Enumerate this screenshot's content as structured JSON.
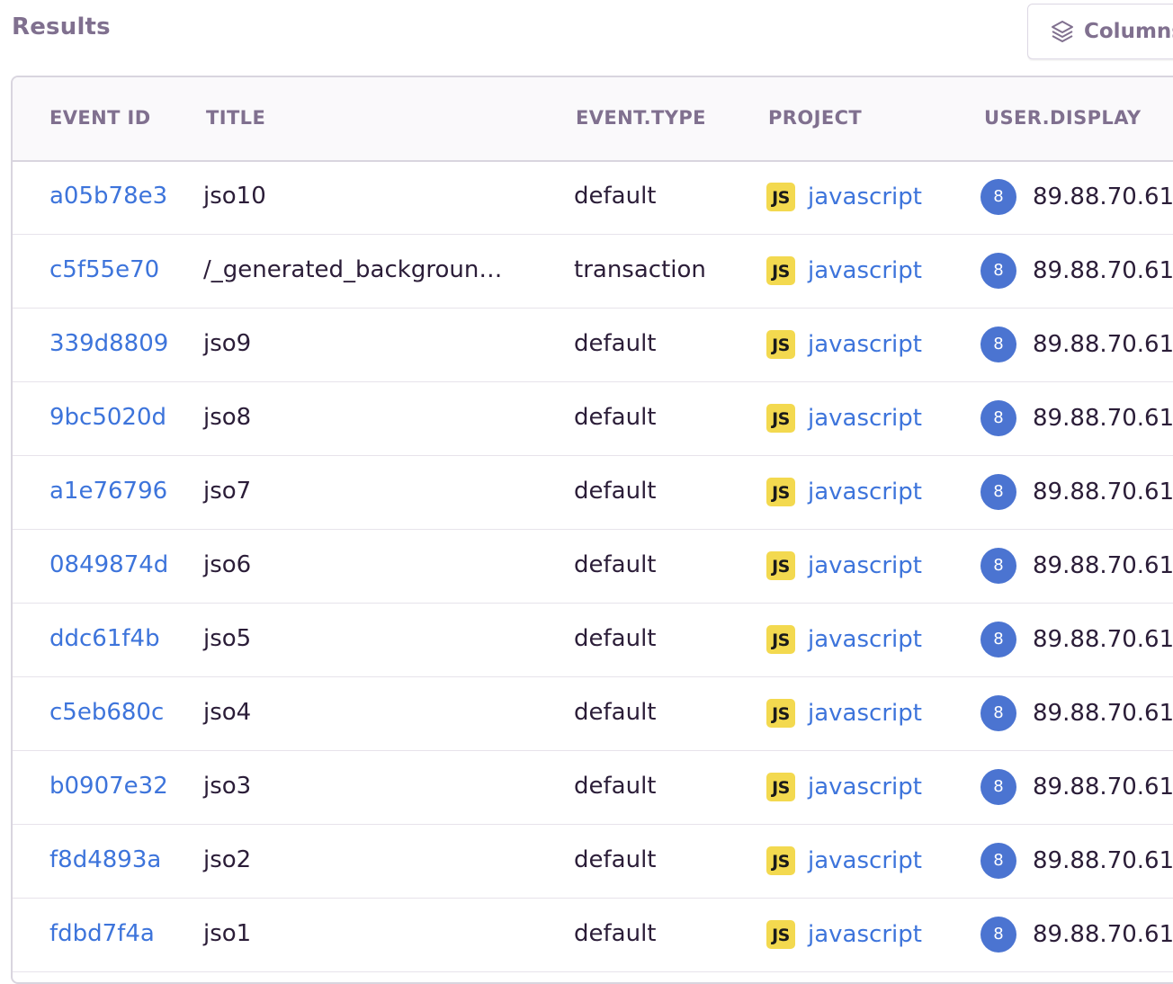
{
  "header": {
    "title": "Results",
    "columns_button_label": "Columns"
  },
  "table": {
    "columns": [
      "EVENT ID",
      "TITLE",
      "EVENT.TYPE",
      "PROJECT",
      "USER.DISPLAY"
    ],
    "rows": [
      {
        "event_id": "a05b78e3",
        "title": "jso10",
        "event_type": "default",
        "project": "javascript",
        "project_badge": "JS",
        "avatar": "8",
        "user_display": "89.88.70.61"
      },
      {
        "event_id": "c5f55e70",
        "title": "/_generated_backgroun…",
        "event_type": "transaction",
        "project": "javascript",
        "project_badge": "JS",
        "avatar": "8",
        "user_display": "89.88.70.61"
      },
      {
        "event_id": "339d8809",
        "title": "jso9",
        "event_type": "default",
        "project": "javascript",
        "project_badge": "JS",
        "avatar": "8",
        "user_display": "89.88.70.61"
      },
      {
        "event_id": "9bc5020d",
        "title": "jso8",
        "event_type": "default",
        "project": "javascript",
        "project_badge": "JS",
        "avatar": "8",
        "user_display": "89.88.70.61"
      },
      {
        "event_id": "a1e76796",
        "title": "jso7",
        "event_type": "default",
        "project": "javascript",
        "project_badge": "JS",
        "avatar": "8",
        "user_display": "89.88.70.61"
      },
      {
        "event_id": "0849874d",
        "title": "jso6",
        "event_type": "default",
        "project": "javascript",
        "project_badge": "JS",
        "avatar": "8",
        "user_display": "89.88.70.61"
      },
      {
        "event_id": "ddc61f4b",
        "title": "jso5",
        "event_type": "default",
        "project": "javascript",
        "project_badge": "JS",
        "avatar": "8",
        "user_display": "89.88.70.61"
      },
      {
        "event_id": "c5eb680c",
        "title": "jso4",
        "event_type": "default",
        "project": "javascript",
        "project_badge": "JS",
        "avatar": "8",
        "user_display": "89.88.70.61"
      },
      {
        "event_id": "b0907e32",
        "title": "jso3",
        "event_type": "default",
        "project": "javascript",
        "project_badge": "JS",
        "avatar": "8",
        "user_display": "89.88.70.61"
      },
      {
        "event_id": "f8d4893a",
        "title": "jso2",
        "event_type": "default",
        "project": "javascript",
        "project_badge": "JS",
        "avatar": "8",
        "user_display": "89.88.70.61"
      },
      {
        "event_id": "fdbd7f4a",
        "title": "jso1",
        "event_type": "default",
        "project": "javascript",
        "project_badge": "JS",
        "avatar": "8",
        "user_display": "89.88.70.61"
      }
    ]
  },
  "icons": {
    "columns_button_icon": "stack-icon"
  },
  "colors": {
    "link": "#3d74db",
    "muted_heading": "#80708f",
    "js_badge": "#f3d94f",
    "avatar": "#4b74d1",
    "text": "#2b1d38"
  }
}
